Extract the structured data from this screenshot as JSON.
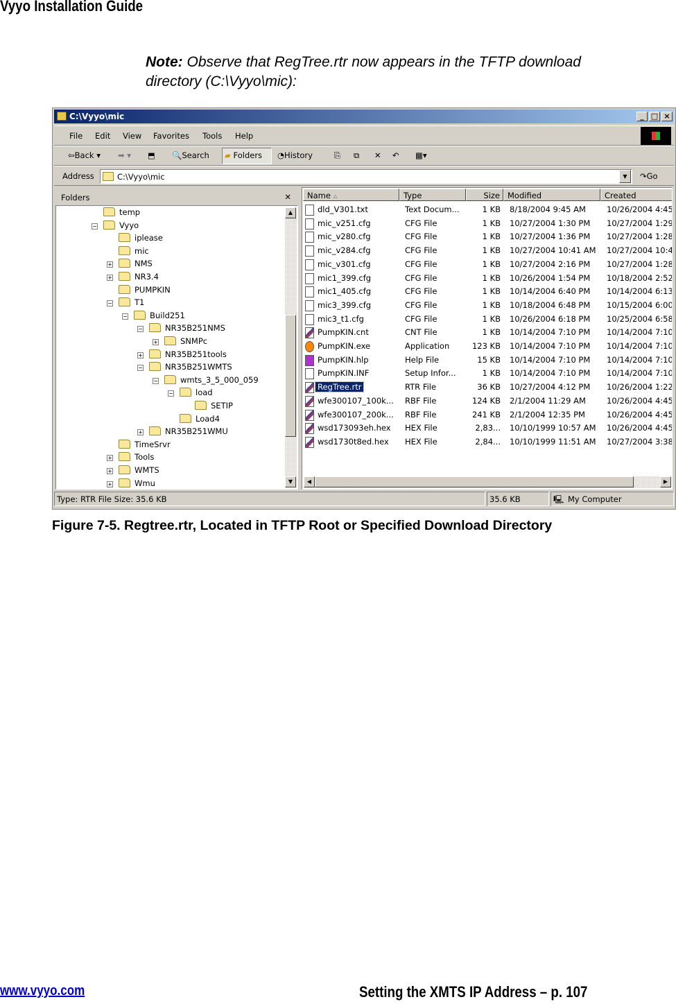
{
  "page": {
    "header": "Vyyo Installation Guide",
    "note_bold": "Note:",
    "note_text": " Observe that RegTree.rtr now appears in the TFTP download directory (C:\\Vyyo\\mic):",
    "caption": "Figure 7-5. Regtree.rtr, Located in TFTP Root or Specified Download Directory",
    "footer_link": "www.vyyo.com",
    "footer_right": "Setting the XMTS IP Address – p. 107"
  },
  "window": {
    "title": "C:\\Vyyo\\mic",
    "menu": [
      "File",
      "Edit",
      "View",
      "Favorites",
      "Tools",
      "Help"
    ],
    "toolbar": {
      "back": "Back",
      "search": "Search",
      "folders": "Folders",
      "history": "History"
    },
    "address_label": "Address",
    "address_value": "C:\\Vyyo\\mic",
    "go": "Go",
    "folders_title": "Folders",
    "tree": [
      {
        "label": "temp",
        "level": 0,
        "expander": ""
      },
      {
        "label": "Vyyo",
        "level": 0,
        "expander": "-"
      },
      {
        "label": "iplease",
        "level": 1,
        "expander": ""
      },
      {
        "label": "mic",
        "level": 1,
        "expander": "",
        "open": true
      },
      {
        "label": "NMS",
        "level": 1,
        "expander": "+"
      },
      {
        "label": "NR3.4",
        "level": 1,
        "expander": "+"
      },
      {
        "label": "PUMPKIN",
        "level": 1,
        "expander": ""
      },
      {
        "label": "T1",
        "level": 1,
        "expander": "-"
      },
      {
        "label": "Build251",
        "level": 2,
        "expander": "-"
      },
      {
        "label": "NR35B251NMS",
        "level": 3,
        "expander": "-"
      },
      {
        "label": "SNMPc",
        "level": 4,
        "expander": "+"
      },
      {
        "label": "NR35B251tools",
        "level": 3,
        "expander": "+"
      },
      {
        "label": "NR35B251WMTS",
        "level": 3,
        "expander": "-"
      },
      {
        "label": "wmts_3_5_000_059",
        "level": 4,
        "expander": "-"
      },
      {
        "label": "load",
        "level": 5,
        "expander": "-"
      },
      {
        "label": "SETIP",
        "level": 6,
        "expander": ""
      },
      {
        "label": "Load4",
        "level": 5,
        "expander": ""
      },
      {
        "label": "NR35B251WMU",
        "level": 3,
        "expander": "+"
      },
      {
        "label": "TimeSrvr",
        "level": 1,
        "expander": ""
      },
      {
        "label": "Tools",
        "level": 1,
        "expander": "+"
      },
      {
        "label": "WMTS",
        "level": 1,
        "expander": "+"
      },
      {
        "label": "Wmu",
        "level": 1,
        "expander": "+"
      }
    ],
    "columns": [
      "Name",
      "Type",
      "Size",
      "Modified",
      "Created"
    ],
    "files": [
      [
        "dld_V301.txt",
        "Text Docum...",
        "1 KB",
        "8/18/2004 9:45 AM",
        "10/26/2004 4:45",
        "text-file-icon"
      ],
      [
        "mic_v251.cfg",
        "CFG File",
        "1 KB",
        "10/27/2004 1:30 PM",
        "10/27/2004 1:29",
        "text-file-icon"
      ],
      [
        "mic_v280.cfg",
        "CFG File",
        "1 KB",
        "10/27/2004 1:36 PM",
        "10/27/2004 1:28",
        "text-file-icon"
      ],
      [
        "mic_v284.cfg",
        "CFG File",
        "1 KB",
        "10/27/2004 10:41 AM",
        "10/27/2004 10:4",
        "text-file-icon"
      ],
      [
        "mic_v301.cfg",
        "CFG File",
        "1 KB",
        "10/27/2004 2:16 PM",
        "10/27/2004 1:28",
        "text-file-icon"
      ],
      [
        "mic1_399.cfg",
        "CFG File",
        "1 KB",
        "10/26/2004 1:54 PM",
        "10/18/2004 2:52",
        "text-file-icon"
      ],
      [
        "mic1_405.cfg",
        "CFG File",
        "1 KB",
        "10/14/2004 6:40 PM",
        "10/14/2004 6:13",
        "text-file-icon"
      ],
      [
        "mic3_399.cfg",
        "CFG File",
        "1 KB",
        "10/18/2004 6:48 PM",
        "10/15/2004 6:00",
        "text-file-icon"
      ],
      [
        "mic3_t1.cfg",
        "CFG File",
        "1 KB",
        "10/26/2004 6:18 PM",
        "10/25/2004 6:58",
        "text-file-icon"
      ],
      [
        "PumpKIN.cnt",
        "CNT File",
        "1 KB",
        "10/14/2004 7:10 PM",
        "10/14/2004 7:10",
        "generic-file-icon"
      ],
      [
        "PumpKIN.exe",
        "Application",
        "123 KB",
        "10/14/2004 7:10 PM",
        "10/14/2004 7:10",
        "application-icon"
      ],
      [
        "PumpKIN.hlp",
        "Help File",
        "15 KB",
        "10/14/2004 7:10 PM",
        "10/14/2004 7:10",
        "help-file-icon"
      ],
      [
        "PumpKIN.INF",
        "Setup Infor...",
        "1 KB",
        "10/14/2004 7:10 PM",
        "10/14/2004 7:10",
        "setup-file-icon"
      ],
      [
        "RegTree.rtr",
        "RTR File",
        "36 KB",
        "10/27/2004 4:12 PM",
        "10/26/2004 1:22",
        "generic-file-icon"
      ],
      [
        "wfe300107_100k...",
        "RBF File",
        "124 KB",
        "2/1/2004 11:29 AM",
        "10/26/2004 4:45",
        "generic-file-icon"
      ],
      [
        "wfe300107_200k...",
        "RBF File",
        "241 KB",
        "2/1/2004 12:35 PM",
        "10/26/2004 4:45",
        "generic-file-icon"
      ],
      [
        "wsd173093eh.hex",
        "HEX File",
        "2,83...",
        "10/10/1999 10:57 AM",
        "10/26/2004 4:45",
        "generic-file-icon"
      ],
      [
        "wsd1730t8ed.hex",
        "HEX File",
        "2,84...",
        "10/10/1999 11:51 AM",
        "10/27/2004 3:38",
        "generic-file-icon"
      ]
    ],
    "selected_file": "RegTree.rtr",
    "status": {
      "info": "Type: RTR File Size: 35.6 KB",
      "size": "35.6 KB",
      "zone": "My Computer"
    },
    "colors": {
      "title_start": "#0a246a",
      "title_end": "#a6caf0",
      "selection": "#0a246a",
      "chrome": "#d4d0c8"
    }
  }
}
